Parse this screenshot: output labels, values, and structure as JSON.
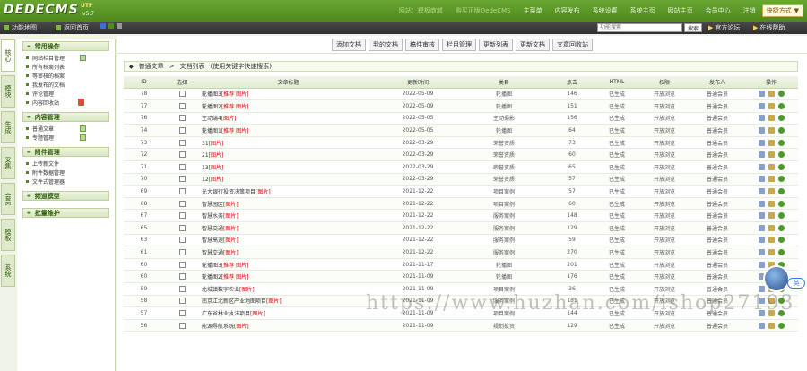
{
  "header": {
    "logo": "DEDECMS",
    "version": "v5.7",
    "badge": "UTF",
    "nav": [
      "网站：模板商城",
      "购买正版DedeCMS",
      "主菜单",
      "内容发布",
      "系统设置",
      "系统主页",
      "网站主页",
      "会员中心",
      "注销"
    ],
    "quick_label": "快捷方式"
  },
  "subbar": {
    "left_items": [
      "功能地图",
      "返回首页"
    ],
    "swatches": [
      "#3a6fd8",
      "#4e8a1c",
      "#999999"
    ],
    "search_placeholder": "功能搜索",
    "search_btn": "搜索",
    "forum": "官方论坛",
    "help": "在线帮助"
  },
  "vtabs": [
    "核心",
    "模块",
    "生成",
    "采集",
    "会员",
    "模板",
    "系统"
  ],
  "leftmenu": [
    {
      "title": "常用操作",
      "items": [
        {
          "label": "网站栏目管理",
          "add": true
        },
        {
          "label": "所有档案列表"
        },
        {
          "label": "等审核的档案"
        },
        {
          "label": "我发布的文档"
        },
        {
          "label": "评论管理"
        },
        {
          "label": "内容回收站",
          "warn": true
        }
      ]
    },
    {
      "title": "内容管理",
      "items": [
        {
          "label": "普通文章",
          "add": true
        },
        {
          "label": "专题管理",
          "add": true
        }
      ]
    },
    {
      "title": "附件管理",
      "items": [
        {
          "label": "上传新文件"
        },
        {
          "label": "附件数据管理"
        },
        {
          "label": "文件式管理器"
        }
      ]
    },
    {
      "title": "频道模型",
      "items": []
    },
    {
      "title": "批量维护",
      "items": []
    }
  ],
  "toolbar": [
    "添加文档",
    "我的文档",
    "稿件审核",
    "栏目管理",
    "更新列表",
    "更新文档",
    "文章回收站"
  ],
  "crumb": {
    "a": "普通文章",
    "b": "文档列表",
    "c": "(使用关键字快速搜索)"
  },
  "table": {
    "headers": [
      "ID",
      "选择",
      "文章标题",
      "更新时间",
      "类目",
      "点击",
      "HTML",
      "权限",
      "发布人",
      "操作"
    ],
    "rows": [
      {
        "id": "78",
        "title": "轮播图3",
        "tags": "[推荐 图片]",
        "date": "2022-05-09",
        "cat": "轮播图",
        "click": "146",
        "html": "已生成",
        "perm": "开放浏览",
        "pub": "普通会员"
      },
      {
        "id": "77",
        "title": "轮播图2",
        "tags": "[推荐 图片]",
        "date": "2022-05-09",
        "cat": "轮播图",
        "click": "151",
        "html": "已生成",
        "perm": "开放浏览",
        "pub": "普通会员"
      },
      {
        "id": "76",
        "title": "主动端4",
        "tags": "[图片]",
        "date": "2022-05-05",
        "cat": "主动摄影",
        "click": "156",
        "html": "已生成",
        "perm": "开放浏览",
        "pub": "普通会员"
      },
      {
        "id": "74",
        "title": "轮播图1",
        "tags": "[推荐 图片]",
        "date": "2022-05-05",
        "cat": "轮播图",
        "click": "64",
        "html": "已生成",
        "perm": "开放浏览",
        "pub": "普通会员"
      },
      {
        "id": "73",
        "title": "31",
        "tags": "[图片]",
        "date": "2022-03-29",
        "cat": "荣誉资质",
        "click": "73",
        "html": "已生成",
        "perm": "开放浏览",
        "pub": "普通会员"
      },
      {
        "id": "72",
        "title": "21",
        "tags": "[图片]",
        "date": "2022-03-29",
        "cat": "荣誉资质",
        "click": "60",
        "html": "已生成",
        "perm": "开放浏览",
        "pub": "普通会员"
      },
      {
        "id": "71",
        "title": "13",
        "tags": "[图片]",
        "date": "2022-03-29",
        "cat": "荣誉资质",
        "click": "65",
        "html": "已生成",
        "perm": "开放浏览",
        "pub": "普通会员"
      },
      {
        "id": "70",
        "title": "12",
        "tags": "[图片]",
        "date": "2022-03-29",
        "cat": "荣誉资质",
        "click": "57",
        "html": "已生成",
        "perm": "开放浏览",
        "pub": "普通会员"
      },
      {
        "id": "69",
        "title": "光大银行投资决策项目",
        "tags": "[图片]",
        "date": "2021-12-22",
        "cat": "项目案例",
        "click": "57",
        "html": "已生成",
        "perm": "开放浏览",
        "pub": "普通会员"
      },
      {
        "id": "68",
        "title": "智慧园区",
        "tags": "[图片]",
        "date": "2021-12-22",
        "cat": "项目案例",
        "click": "60",
        "html": "已生成",
        "perm": "开放浏览",
        "pub": "普通会员"
      },
      {
        "id": "67",
        "title": "智慧水务",
        "tags": "[图片]",
        "date": "2021-12-22",
        "cat": "服务案例",
        "click": "148",
        "html": "已生成",
        "perm": "开放浏览",
        "pub": "普通会员"
      },
      {
        "id": "65",
        "title": "智慧交通",
        "tags": "[图片]",
        "date": "2021-12-22",
        "cat": "服务案例",
        "click": "129",
        "html": "已生成",
        "perm": "开放浏览",
        "pub": "普通会员"
      },
      {
        "id": "63",
        "title": "智慧高速",
        "tags": "[图片]",
        "date": "2021-12-22",
        "cat": "服务案例",
        "click": "59",
        "html": "已生成",
        "perm": "开放浏览",
        "pub": "普通会员"
      },
      {
        "id": "61",
        "title": "智慧交通",
        "tags": "[图片]",
        "date": "2021-12-22",
        "cat": "服务案例",
        "click": "270",
        "html": "已生成",
        "perm": "开放浏览",
        "pub": "普通会员"
      },
      {
        "id": "60",
        "title": "轮播图3",
        "tags": "[推荐 图片]",
        "date": "2021-11-17",
        "cat": "轮播图",
        "click": "201",
        "html": "已生成",
        "perm": "开放浏览",
        "pub": "普通会员"
      },
      {
        "id": "60",
        "title": "轮播图2",
        "tags": "[推荐 图片]",
        "date": "2021-11-09",
        "cat": "轮播图",
        "click": "176",
        "html": "已生成",
        "perm": "开放浏览",
        "pub": "普通会员"
      },
      {
        "id": "59",
        "title": "北城镇数字农业",
        "tags": "[图片]",
        "date": "2021-11-09",
        "cat": "项目案例",
        "click": "36",
        "html": "已生成",
        "perm": "开放浏览",
        "pub": "普通会员"
      },
      {
        "id": "58",
        "title": "南京江北新区产业地图项目",
        "tags": "[图片]",
        "date": "2021-11-09",
        "cat": "服务案例",
        "click": "131",
        "html": "已生成",
        "perm": "开放浏览",
        "pub": "普通会员"
      },
      {
        "id": "57",
        "title": "广东省林业执法项目",
        "tags": "[图片]",
        "date": "2021-11-09",
        "cat": "项目案例",
        "click": "144",
        "html": "已生成",
        "perm": "开放浏览",
        "pub": "普通会员"
      },
      {
        "id": "56",
        "title": "能源导航系统",
        "tags": "[图片]",
        "date": "2021-11-09",
        "cat": "规划投资",
        "click": "129",
        "html": "已生成",
        "perm": "开放浏览",
        "pub": "普通会员"
      }
    ]
  },
  "watermark": "https://www.huzhan.com/ishop27193",
  "avatar_tag": "英"
}
